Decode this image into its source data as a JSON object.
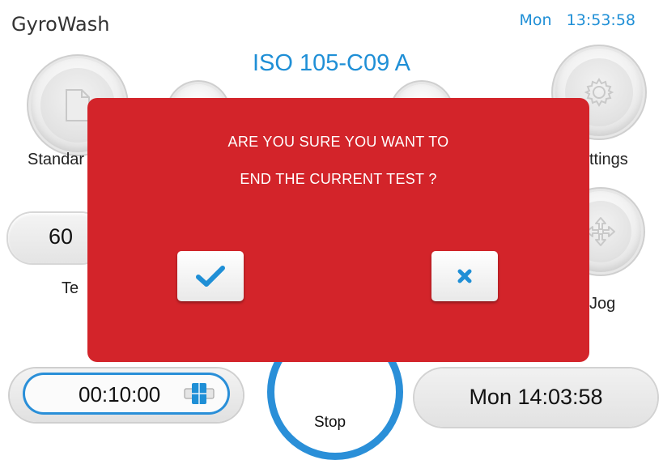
{
  "app": {
    "title": "GyroWash"
  },
  "clock": {
    "text": "Mon   13:53:58"
  },
  "program": {
    "title": "ISO 105-C09 A"
  },
  "left_column": {
    "standard_label": "Standar",
    "temp_value": "60",
    "temp_label": "Te"
  },
  "right_column": {
    "settings_label": "ttings",
    "jog_label": "Jog"
  },
  "timer": {
    "value": "00:10:00"
  },
  "end_time": {
    "value": "Mon 14:03:58"
  },
  "stop": {
    "label": "Stop"
  },
  "dialog": {
    "line1": "ARE YOU SURE YOU WANT TO",
    "line2": "END THE CURRENT TEST ?",
    "confirm_icon": "checkmark-icon",
    "cancel_icon": "x-icon"
  },
  "colors": {
    "accent": "#1f8fd6",
    "dialog_bg": "#d3242a",
    "button_icon": "#1f8fd6"
  }
}
